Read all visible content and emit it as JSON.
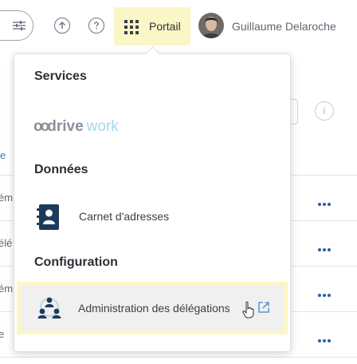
{
  "header": {
    "portail_label": "Portail",
    "user_name": "Guillaume Delaroche"
  },
  "dropdown": {
    "sections": {
      "services": "Services",
      "donnees": "Données",
      "configuration": "Configuration"
    },
    "logo": {
      "part1": "oo",
      "part2": "drive",
      "part3": "work"
    },
    "items": {
      "carnet": "Carnet d'adresses",
      "administration": "Administration des délégations"
    }
  },
  "background": {
    "link_text": "e",
    "rows": [
      "ém",
      "élé",
      "ém",
      "e"
    ],
    "info_glyph": "i"
  },
  "colors": {
    "highlight": "#fbf6c6",
    "accent": "#2a5fa8",
    "logo_work": "#a9d6ee"
  }
}
